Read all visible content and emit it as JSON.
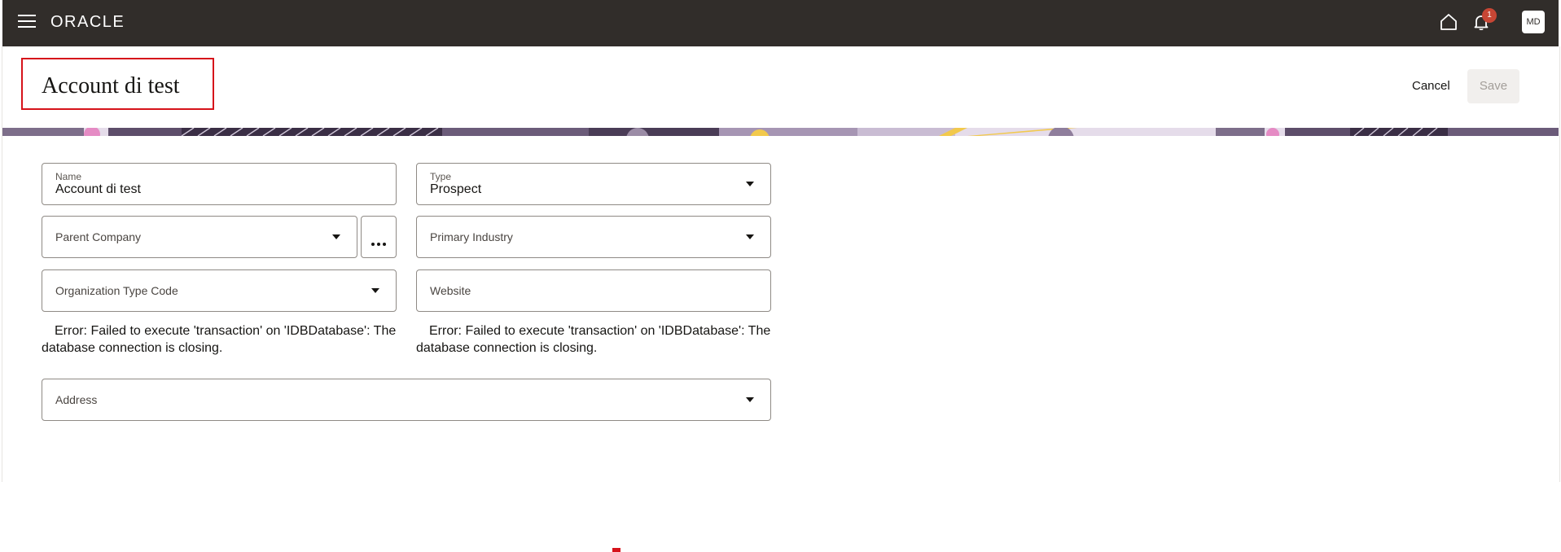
{
  "header": {
    "logo": "ORACLE",
    "notification_count": "1",
    "avatar_initials": "MD"
  },
  "page": {
    "title": "Account di test",
    "cancel_label": "Cancel",
    "save_label": "Save"
  },
  "form": {
    "name": {
      "label": "Name",
      "value": "Account di test"
    },
    "type": {
      "label": "Type",
      "value": "Prospect"
    },
    "parent_company": {
      "placeholder": "Parent Company"
    },
    "primary_industry": {
      "placeholder": "Primary Industry"
    },
    "organization_type_code": {
      "placeholder": "Organization Type Code"
    },
    "website": {
      "placeholder": "Website"
    },
    "error_left": "Error: Failed to execute 'transaction' on 'IDBDatabase': The database connection is closing.",
    "error_right": "Error: Failed to execute 'transaction' on 'IDBDatabase': The database connection is closing.",
    "address": {
      "placeholder": "Address"
    }
  },
  "colors": {
    "topbar": "#312d2a",
    "badge": "#c74634",
    "highlight_border": "#d6131b"
  },
  "icons": [
    "hamburger-menu-icon",
    "home-icon",
    "bell-icon",
    "chevron-down-icon",
    "more-options-icon"
  ]
}
